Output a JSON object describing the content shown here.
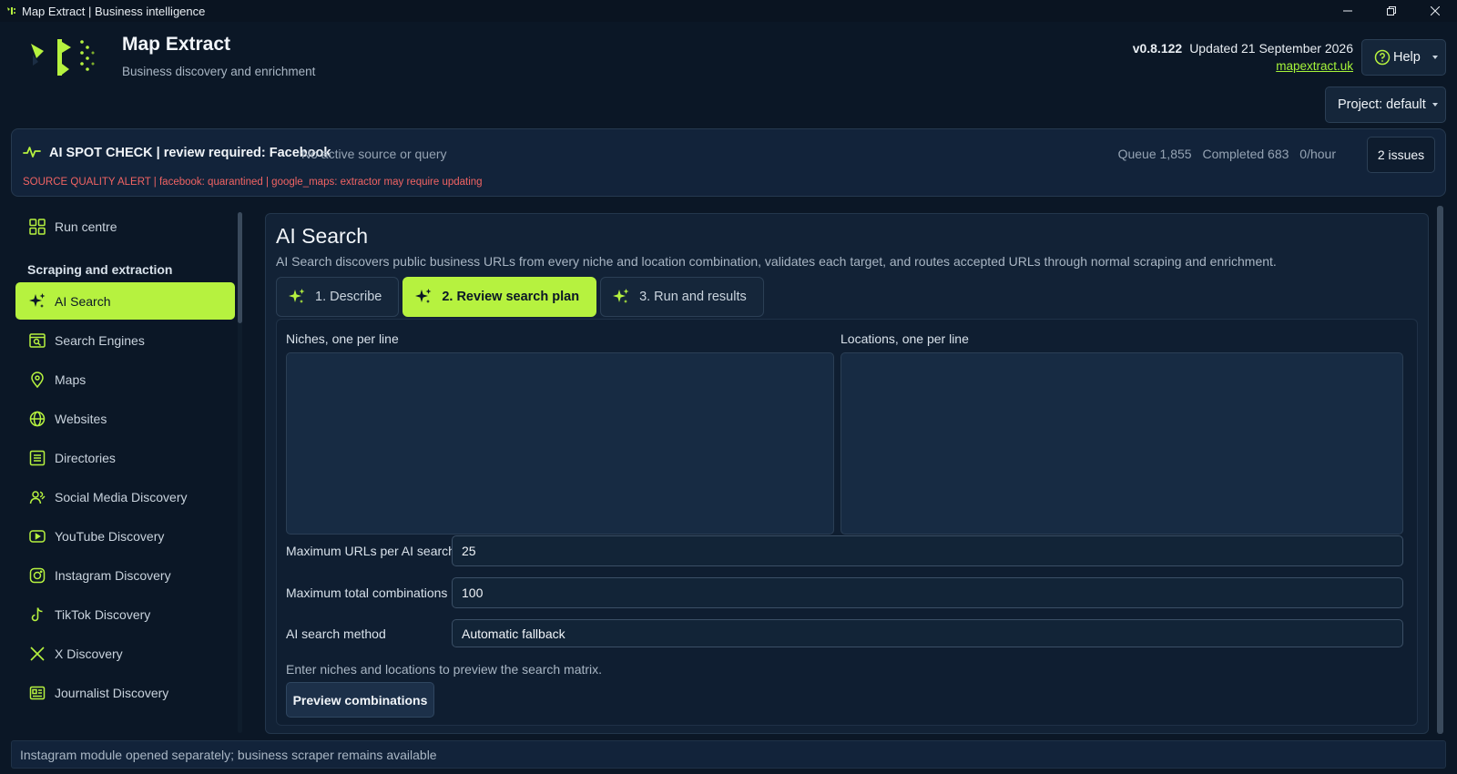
{
  "window": {
    "title": "Map Extract | Business intelligence"
  },
  "header": {
    "app_name": "Map Extract",
    "tagline": "Business discovery and enrichment",
    "version": "v0.8.122",
    "updated": "Updated 21 September 2026",
    "site_link": "mapextract.uk",
    "help_label": "Help",
    "project_label": "Project: default"
  },
  "alert": {
    "title": "AI SPOT CHECK | review required: Facebook",
    "subtitle": "No active source or query",
    "quality": "SOURCE QUALITY ALERT | facebook: quarantined | google_maps: extractor may require updating",
    "queue": "Queue 1,855",
    "completed": "Completed 683",
    "rate": "0/hour",
    "issues_label": "2 issues"
  },
  "sidebar": {
    "section_label": "Scraping and extraction",
    "items": [
      {
        "label": "Run centre",
        "icon": "grid-icon"
      },
      {
        "label": "AI Search",
        "icon": "sparkle-icon"
      },
      {
        "label": "Search Engines",
        "icon": "search-engine-icon"
      },
      {
        "label": "Maps",
        "icon": "map-pin-icon"
      },
      {
        "label": "Websites",
        "icon": "globe-icon"
      },
      {
        "label": "Directories",
        "icon": "directory-icon"
      },
      {
        "label": "Social Media Discovery",
        "icon": "people-icon"
      },
      {
        "label": "YouTube Discovery",
        "icon": "youtube-icon"
      },
      {
        "label": "Instagram Discovery",
        "icon": "instagram-icon"
      },
      {
        "label": "TikTok Discovery",
        "icon": "tiktok-icon"
      },
      {
        "label": "X Discovery",
        "icon": "x-icon"
      },
      {
        "label": "Journalist Discovery",
        "icon": "newspaper-icon"
      }
    ],
    "active": "AI Search"
  },
  "main": {
    "title": "AI Search",
    "description": "AI Search discovers public business URLs from every niche and location combination, validates each target, and routes accepted URLs through normal scraping and enrichment.",
    "tabs": [
      {
        "label": "1. Describe"
      },
      {
        "label": "2. Review search plan"
      },
      {
        "label": "3. Run and results"
      }
    ],
    "active_tab": "2. Review search plan",
    "form": {
      "niches_label": "Niches, one per line",
      "niches_value": "",
      "locations_label": "Locations, one per line",
      "locations_value": "",
      "max_urls_label": "Maximum URLs per AI search",
      "max_urls_value": "25",
      "max_combos_label": "Maximum total combinations",
      "max_combos_value": "100",
      "method_label": "AI search method",
      "method_value": "Automatic fallback",
      "hint": "Enter niches and locations to preview the search matrix.",
      "preview_button": "Preview combinations"
    }
  },
  "status_bar": {
    "message": "Instagram module opened separately; business scraper remains available"
  },
  "colors": {
    "accent": "#b6f23f",
    "background": "#0b1726",
    "panel": "#122236",
    "alert_red": "#f06363"
  }
}
